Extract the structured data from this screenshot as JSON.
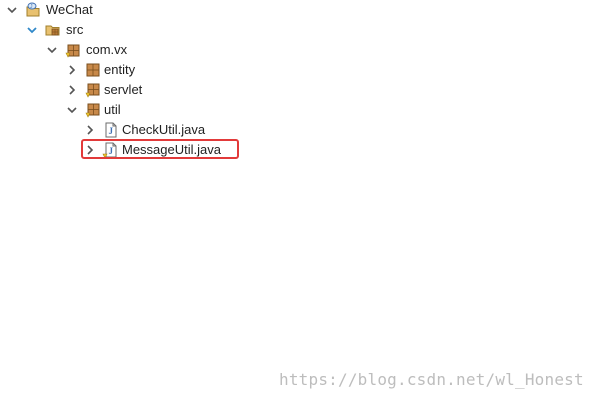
{
  "tree": {
    "project": "WeChat",
    "src": "src",
    "package_root": "com.vx",
    "package_entity": "entity",
    "package_servlet": "servlet",
    "package_util": "util",
    "file_check": "CheckUtil.java",
    "file_message": "MessageUtil.java"
  },
  "watermark": "https://blog.csdn.net/wl_Honest",
  "colors": {
    "highlight_border": "#e23a3a",
    "package_brown": "#b97a34",
    "java_blue": "#3f6fb2",
    "twistie": "#555555"
  },
  "icons": {
    "project": "java-project-icon",
    "source_folder": "source-folder-icon",
    "package": "package-icon",
    "java_file": "java-file-icon"
  }
}
